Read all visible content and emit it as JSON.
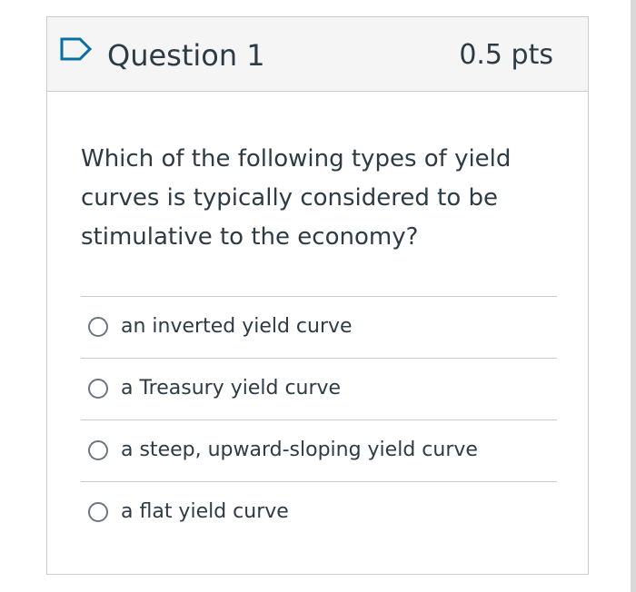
{
  "question": {
    "title": "Question 1",
    "points": "0.5 pts",
    "flag_icon": "flag-outline-icon",
    "text": "Which of the following types of yield curves is typically considered to be stimulative to the economy?"
  },
  "answers": [
    {
      "label": "an inverted yield curve",
      "selected": false
    },
    {
      "label": "a Treasury yield curve",
      "selected": false
    },
    {
      "label": "a steep, upward-sloping yield curve",
      "selected": false
    },
    {
      "label": "a flat yield curve",
      "selected": false
    }
  ],
  "colors": {
    "accent": "#0770a3",
    "text": "#2d3b45",
    "header_bg": "#f5f5f5",
    "border": "#c7cdd1"
  }
}
